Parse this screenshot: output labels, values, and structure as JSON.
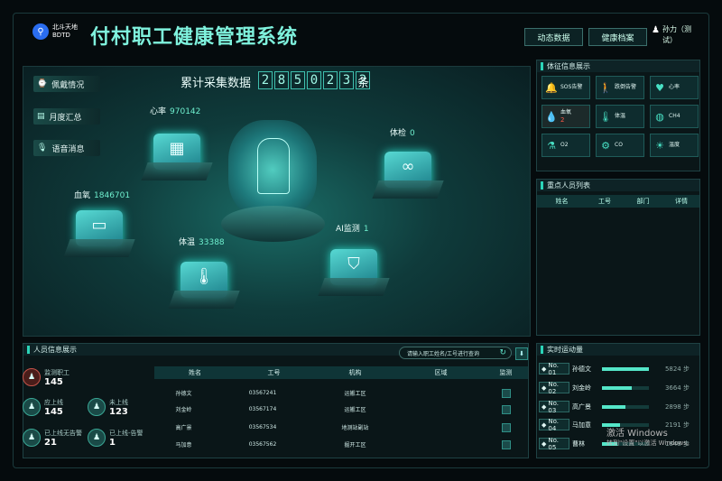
{
  "header": {
    "logo_cn": "北斗天地",
    "logo_en": "BDTD",
    "title": "付村职工健康管理系统",
    "btn_dynamic": "动态数据",
    "btn_archive": "健康档案",
    "user_name": "孙力（测",
    "user_name2": "试）"
  },
  "sidebar": {
    "items": [
      {
        "label": "佩戴情况"
      },
      {
        "label": "月度汇总"
      },
      {
        "label": "语音消息"
      }
    ]
  },
  "collect": {
    "label": "累计采集数据",
    "digits": [
      "2",
      "8",
      "5",
      "0",
      "2",
      "3",
      "2"
    ],
    "unit": "条"
  },
  "stats": {
    "heart_label": "心率",
    "heart_value": "970142",
    "checkup_label": "体检",
    "checkup_value": "0",
    "oxygen_label": "血氧",
    "oxygen_value": "1846701",
    "ai_label": "AI监测",
    "ai_value": "1",
    "temp_label": "体温",
    "temp_value": "33388"
  },
  "vitals_panel": {
    "title": "体征信息展示",
    "items": [
      {
        "label": "SOS告警",
        "icon": "bell-icon"
      },
      {
        "label": "跌倒告警",
        "icon": "fall-icon"
      },
      {
        "label": "心率",
        "icon": "heart-icon"
      },
      {
        "label": "血氧",
        "value": "2",
        "icon": "drop-icon"
      },
      {
        "label": "体温",
        "icon": "thermo-icon"
      },
      {
        "label": "CH4",
        "icon": "gas-icon"
      },
      {
        "label": "O2",
        "icon": "o2-icon"
      },
      {
        "label": "CO",
        "icon": "co-icon"
      },
      {
        "label": "温度",
        "icon": "temp-icon"
      }
    ]
  },
  "key_persons": {
    "title": "重点人员列表",
    "columns": [
      "姓名",
      "工号",
      "部门",
      "详情"
    ]
  },
  "persons": {
    "title": "人员信息展示",
    "search_placeholder": "请输入职工姓名/工号进行查询",
    "counts": [
      {
        "label": "监测职工",
        "value": "145"
      },
      {
        "label": "应上线",
        "value": "145"
      },
      {
        "label": "未上线",
        "value": "123"
      },
      {
        "label": "已上线无告警",
        "value": "21"
      },
      {
        "label": "已上线-告警",
        "value": "1"
      }
    ],
    "columns": [
      "姓名",
      "工号",
      "机构",
      "区域",
      "监测"
    ],
    "rows": [
      {
        "name": "孙德文",
        "id": "03567241",
        "org": "运搬工区"
      },
      {
        "name": "刘金岭",
        "id": "03567174",
        "org": "运搬工区"
      },
      {
        "name": "高广景",
        "id": "03567534",
        "org": "地测站副站"
      },
      {
        "name": "马加意",
        "id": "03567562",
        "org": "掘开工区"
      }
    ]
  },
  "activity": {
    "title": "实时运动量",
    "unit": "步",
    "ranks": [
      {
        "no": "No. 01",
        "name": "孙德文",
        "value": "5824",
        "ratio": 1.0
      },
      {
        "no": "No. 02",
        "name": "刘金岭",
        "value": "3664",
        "ratio": 0.63
      },
      {
        "no": "No. 03",
        "name": "高广景",
        "value": "2898",
        "ratio": 0.5
      },
      {
        "no": "No. 04",
        "name": "马加意",
        "value": "2191",
        "ratio": 0.38
      },
      {
        "no": "No. 05",
        "name": "曹林",
        "value": "1848",
        "ratio": 0.32
      }
    ]
  },
  "watermark": {
    "line1": "激活 Windows",
    "line2": "转到\"设置\"以激活 Windows。"
  },
  "colors": {
    "accent": "#2bd4b8",
    "alarm": "#ff5a48",
    "title": "#7ff2dd"
  }
}
